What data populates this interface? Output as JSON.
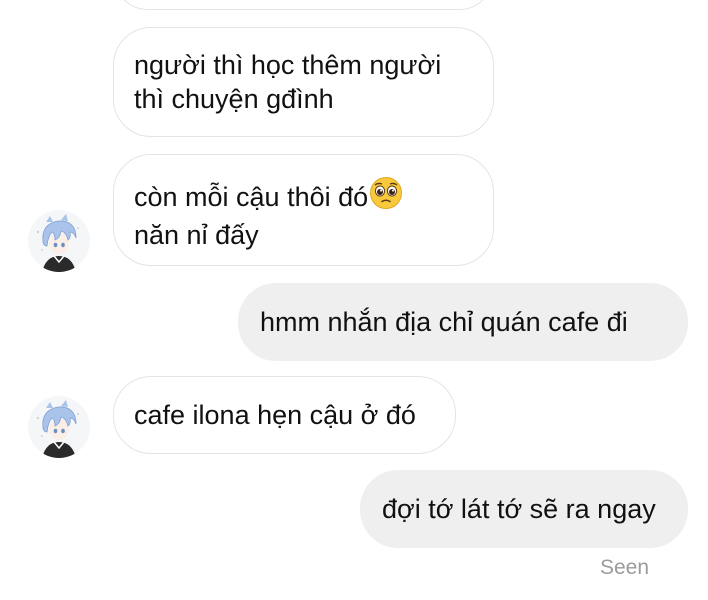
{
  "messages": [
    {
      "side": "incoming",
      "lines": [
        "người thì học thêm người",
        "thì chuyện gđình"
      ]
    },
    {
      "side": "incoming",
      "lines": [
        "còn mỗi cậu thôi đó",
        "năn nỉ đấy"
      ],
      "emoji": "pleading-face"
    },
    {
      "side": "outgoing",
      "lines": [
        "hmm nhắn địa chỉ quán cafe đi"
      ]
    },
    {
      "side": "incoming",
      "lines": [
        "cafe ilona hẹn cậu ở đó"
      ]
    },
    {
      "side": "outgoing",
      "lines": [
        "đợi tớ lát tớ sẽ ra ngay"
      ]
    }
  ],
  "status": {
    "seen": "Seen"
  },
  "colors": {
    "incoming_bubble": "#ffffff",
    "incoming_border": "#e4e4e4",
    "outgoing_bubble": "#efefef",
    "text": "#111111",
    "seen_text": "#9b9b9b",
    "avatar_hair": "#a9c3ea"
  },
  "icons": [
    "avatar",
    "pleading-face-emoji"
  ]
}
